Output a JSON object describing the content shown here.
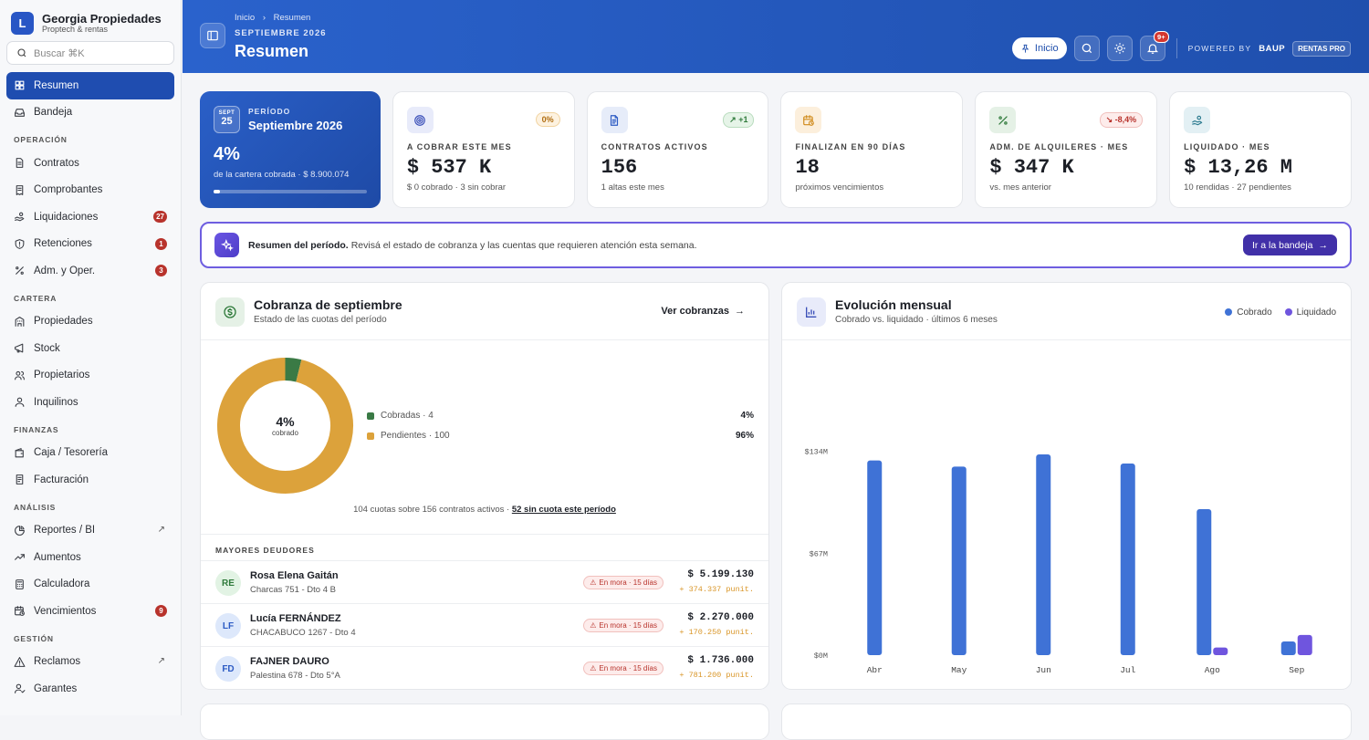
{
  "brand": {
    "logo_letter": "L",
    "name": "Georgia Propiedades",
    "tagline": "Proptech & rentas"
  },
  "search": {
    "placeholder": "Buscar ⌘K"
  },
  "sidebar": {
    "top": [
      {
        "label": "Resumen",
        "icon": "grid-icon",
        "active": true
      },
      {
        "label": "Bandeja",
        "icon": "inbox-icon"
      }
    ],
    "sections": [
      {
        "title": "OPERACIÓN",
        "items": [
          {
            "label": "Contratos",
            "icon": "document-icon"
          },
          {
            "label": "Comprobantes",
            "icon": "receipt-icon"
          },
          {
            "label": "Liquidaciones",
            "icon": "hand-coins-icon",
            "badge": "27"
          },
          {
            "label": "Retenciones",
            "icon": "shield-icon",
            "badge": "1"
          },
          {
            "label": "Adm. y Oper.",
            "icon": "percent-icon",
            "badge": "3"
          }
        ]
      },
      {
        "title": "CARTERA",
        "items": [
          {
            "label": "Propiedades",
            "icon": "building-icon"
          },
          {
            "label": "Stock",
            "icon": "megaphone-icon"
          },
          {
            "label": "Propietarios",
            "icon": "users-icon"
          },
          {
            "label": "Inquilinos",
            "icon": "user-icon"
          }
        ]
      },
      {
        "title": "FINANZAS",
        "items": [
          {
            "label": "Caja / Tesorería",
            "icon": "wallet-icon"
          },
          {
            "label": "Facturación",
            "icon": "invoice-icon"
          }
        ]
      },
      {
        "title": "ANÁLISIS",
        "items": [
          {
            "label": "Reportes / BI",
            "icon": "pie-chart-icon",
            "external": "↗"
          },
          {
            "label": "Aumentos",
            "icon": "trend-up-icon"
          },
          {
            "label": "Calculadora",
            "icon": "calculator-icon"
          },
          {
            "label": "Vencimientos",
            "icon": "calendar-clock-icon",
            "badge": "9"
          }
        ]
      },
      {
        "title": "GESTIÓN",
        "items": [
          {
            "label": "Reclamos",
            "icon": "alert-icon",
            "external": "↗"
          },
          {
            "label": "Garantes",
            "icon": "user-check-icon"
          }
        ]
      }
    ]
  },
  "header": {
    "breadcrumb_home": "Inicio",
    "breadcrumb_sep": "›",
    "breadcrumb_current": "Resumen",
    "month": "SEPTIEMBRE 2026",
    "title": "Resumen",
    "home_pill": "Inicio",
    "notif_badge": "9+",
    "powered_by": "POWERED BY",
    "powered_brand": "BAUP",
    "plan": "RENTAS PRO"
  },
  "kpis": {
    "hero": {
      "cal_month": "SEPT",
      "cal_day": "25",
      "label": "PERÍODO",
      "period": "Septiembre 2026",
      "value": "4%",
      "sub": "de la cartera cobrada · $ 8.900.074",
      "progress": 0.04
    },
    "cards": [
      {
        "icon": "target-icon",
        "chip": "0%",
        "chip_tone": "warn",
        "label": "A COBRAR ESTE MES",
        "value": "$ 537 K",
        "sub": "$ 0 cobrado · 3 sin cobrar",
        "icon_bg": "#e8ebfa",
        "icon_color": "#3a4fb8"
      },
      {
        "icon": "file-text-icon",
        "chip": "+1",
        "chip_tone": "up",
        "label": "CONTRATOS ACTIVOS",
        "value": "156",
        "sub": "1 altas este mes",
        "icon_bg": "#e6ecf9",
        "icon_color": "#2d5bc4"
      },
      {
        "icon": "calendar-clock-icon",
        "chip": "",
        "chip_tone": "",
        "label": "FINALIZAN EN 90 DÍAS",
        "value": "18",
        "sub": "próximos vencimientos",
        "icon_bg": "#fcefdc",
        "icon_color": "#d08a1a"
      },
      {
        "icon": "percent-icon",
        "chip": "-8,4%",
        "chip_tone": "down",
        "label": "ADM. DE ALQUILERES · MES",
        "value": "$ 347 K",
        "sub": "vs. mes anterior",
        "icon_bg": "#e5f1e6",
        "icon_color": "#2f7a3b"
      },
      {
        "icon": "hand-coins-icon",
        "chip": "",
        "chip_tone": "",
        "label": "LIQUIDADO · MES",
        "value": "$ 13,26 M",
        "sub": "10 rendidas · 27 pendientes",
        "icon_bg": "#e3f0f4",
        "icon_color": "#2b7a8f"
      }
    ]
  },
  "banner": {
    "strong": "Resumen del período.",
    "text": "Revisá el estado de cobranza y las cuentas que requieren atención esta semana.",
    "button": "Ir a la bandeja"
  },
  "cobranza": {
    "title": "Cobranza de septiembre",
    "subtitle": "Estado de las cuotas del período",
    "link": "Ver cobranzas",
    "center_value": "4%",
    "center_label": "cobrado",
    "legend": [
      {
        "label": "Cobradas · 4",
        "pct": "4%",
        "value": 4,
        "color": "#3a7a45"
      },
      {
        "label": "Pendientes · 100",
        "pct": "96%",
        "value": 100,
        "color": "#dca23b"
      }
    ],
    "footer": "104 cuotas sobre 156 contratos activos ·",
    "footer_link": "52 sin cuota este período",
    "debtors_title": "MAYORES DEUDORES",
    "mora_label": "En mora · 15 días",
    "debtors": [
      {
        "initials": "RE",
        "name": "Rosa Elena Gaitán",
        "address": "Charcas 751 - Dto 4 B",
        "amount": "$ 5.199.130",
        "punit": "+ 374.337 punit.",
        "av_bg": "#e2f3e4",
        "av_color": "#2f7a3b"
      },
      {
        "initials": "LF",
        "name": "Lucía FERNÁNDEZ",
        "address": "CHACABUCO 1267 - Dto 4",
        "amount": "$ 2.270.000",
        "punit": "+ 170.250 punit.",
        "av_bg": "#dde8fb",
        "av_color": "#2d5bc4"
      },
      {
        "initials": "FD",
        "name": "FAJNER DAURO",
        "address": "Palestina 678 - Dto 5°A",
        "amount": "$ 1.736.000",
        "punit": "+ 781.200 punit.",
        "av_bg": "#dde8fb",
        "av_color": "#2d5bc4"
      }
    ]
  },
  "evolucion": {
    "title": "Evolución mensual",
    "subtitle": "Cobrado vs. liquidado · últimos 6 meses"
  },
  "chart_data": {
    "type": "bar",
    "title": "Evolución mensual",
    "categories": [
      "Abr",
      "May",
      "Jun",
      "Jul",
      "Ago",
      "Sep"
    ],
    "series": [
      {
        "name": "Cobrado",
        "color": "#3f72d6",
        "values": [
          128,
          124,
          132,
          126,
          96,
          9
        ]
      },
      {
        "name": "Liquidado",
        "color": "#6f55de",
        "values": [
          0,
          0,
          0,
          0,
          5,
          13.26
        ]
      }
    ],
    "ylim": [
      0,
      150
    ],
    "yticks": [
      {
        "v": 0,
        "label": "$0M"
      },
      {
        "v": 67,
        "label": "$67M"
      },
      {
        "v": 134,
        "label": "$134M"
      }
    ],
    "legend_position": "top-right",
    "grid": false
  }
}
